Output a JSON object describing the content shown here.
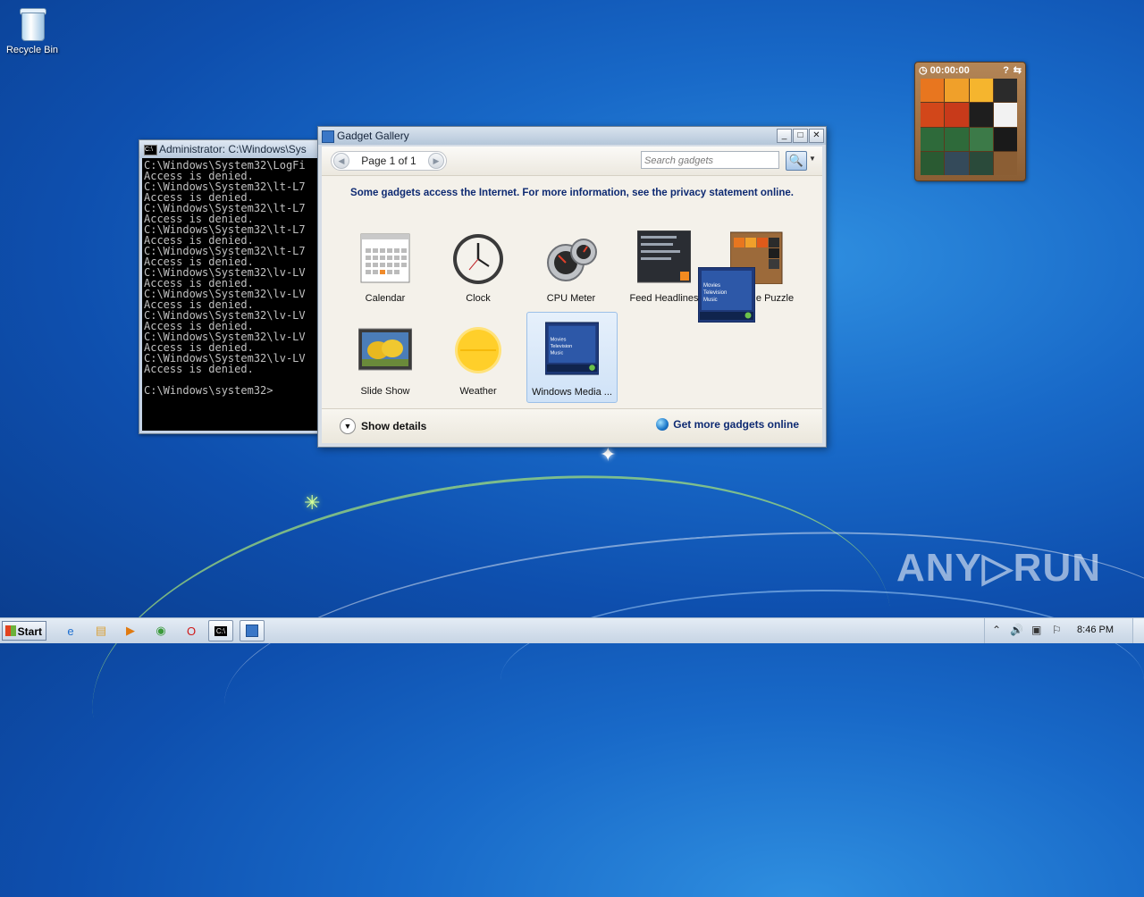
{
  "desktop": {
    "icons": [
      {
        "label": "Recycle Bin",
        "icon": "recycle-bin-icon"
      }
    ],
    "watermark": "ANY▷RUN"
  },
  "cmd_window": {
    "title": "Administrator: C:\\Windows\\Sys",
    "lines": [
      "C:\\Windows\\System32\\LogFi",
      "Access is denied.",
      "C:\\Windows\\System32\\lt-L7",
      "Access is denied.",
      "C:\\Windows\\System32\\lt-L7",
      "Access is denied.",
      "C:\\Windows\\System32\\lt-L7",
      "Access is denied.",
      "C:\\Windows\\System32\\lt-L7",
      "Access is denied.",
      "C:\\Windows\\System32\\lv-LV",
      "Access is denied.",
      "C:\\Windows\\System32\\lv-LV",
      "Access is denied.",
      "C:\\Windows\\System32\\lv-LV",
      "Access is denied.",
      "C:\\Windows\\System32\\lv-LV",
      "Access is denied.",
      "C:\\Windows\\System32\\lv-LV",
      "Access is denied.",
      "",
      "C:\\Windows\\system32>"
    ]
  },
  "gadget_gallery": {
    "title": "Gadget Gallery",
    "page_label": "Page 1 of 1",
    "search_placeholder": "Search gadgets",
    "privacy_text": "Some gadgets access the Internet.  For more information, see the privacy statement online.",
    "gadgets": [
      {
        "label": "Calendar",
        "icon": "calendar-icon"
      },
      {
        "label": "Clock",
        "icon": "clock-icon"
      },
      {
        "label": "CPU Meter",
        "icon": "cpu-meter-icon"
      },
      {
        "label": "Feed Headlines",
        "icon": "feed-headlines-icon"
      },
      {
        "label": "e Puzzle",
        "icon": "picture-puzzle-icon"
      },
      {
        "label": "Slide Show",
        "icon": "slide-show-icon"
      },
      {
        "label": "Weather",
        "icon": "weather-icon"
      },
      {
        "label": "Windows Media ...",
        "icon": "windows-media-center-icon",
        "selected": true
      }
    ],
    "drag_tile": {
      "lines": [
        "Movies",
        "Television",
        "Music"
      ]
    },
    "media_tile": {
      "lines": [
        "Movies",
        "Television",
        "Music"
      ]
    },
    "show_details": "Show details",
    "get_more": "Get more gadgets online"
  },
  "puzzle_gadget": {
    "timer": "00:00:00"
  },
  "taskbar": {
    "start_label": "Start",
    "pinned": [
      "internet-explorer-icon",
      "explorer-icon",
      "media-player-icon",
      "chrome-icon",
      "opera-icon"
    ],
    "tasks": [
      "cmd-task-icon",
      "gadget-gallery-task-icon"
    ],
    "clock": "8:46 PM"
  }
}
